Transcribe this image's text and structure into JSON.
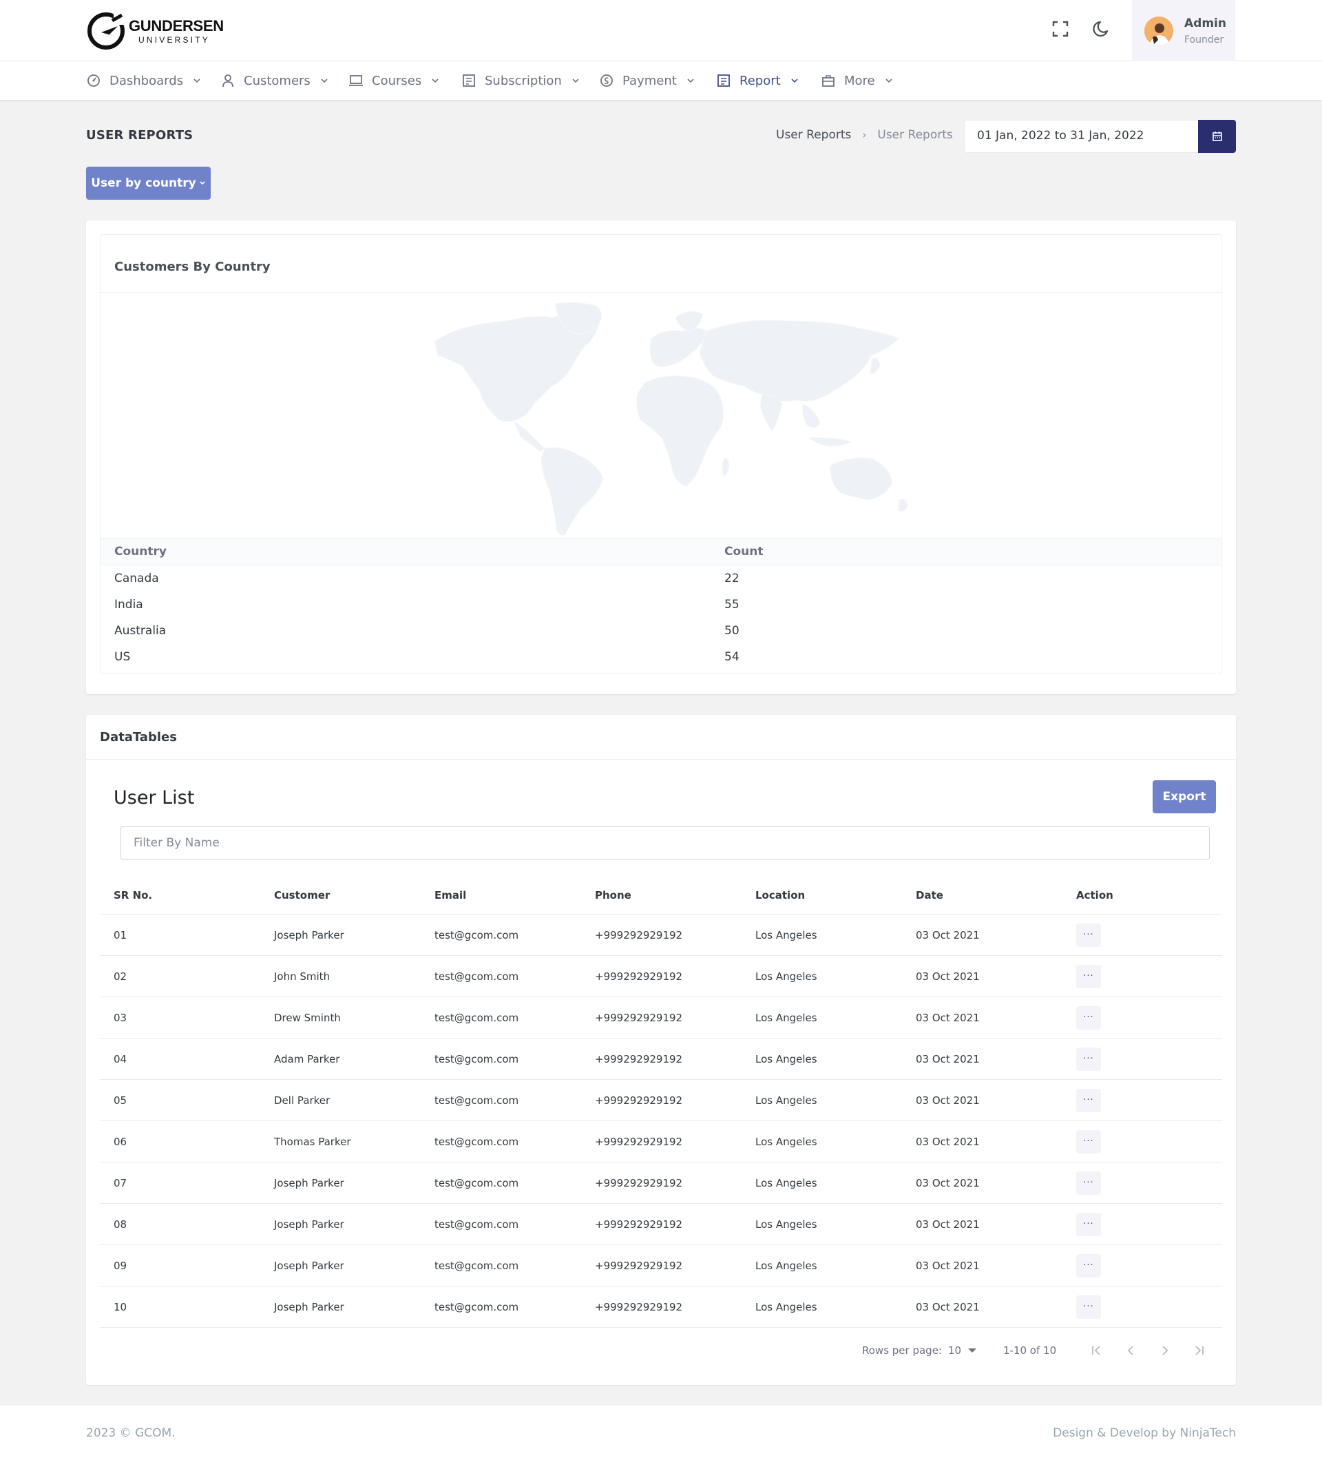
{
  "brand": {
    "name": "GUNDERSEN",
    "sub": "UNIVERSITY"
  },
  "header": {
    "icons": [
      "fullscreen-icon",
      "moon-icon"
    ],
    "user": {
      "name": "Admin",
      "role": "Founder"
    }
  },
  "nav": [
    {
      "label": "Dashboards",
      "icon": "dashboard-icon"
    },
    {
      "label": "Customers",
      "icon": "user-icon"
    },
    {
      "label": "Courses",
      "icon": "laptop-icon"
    },
    {
      "label": "Subscription",
      "icon": "subscription-icon"
    },
    {
      "label": "Payment",
      "icon": "coins-icon"
    },
    {
      "label": "Report",
      "icon": "report-icon",
      "active": true
    },
    {
      "label": "More",
      "icon": "briefcase-icon"
    }
  ],
  "page": {
    "title": "USER REPORTS",
    "breadcrumb": [
      "User Reports",
      "User Reports"
    ],
    "date_range": "01 Jan, 2022 to 31 Jan, 2022",
    "filter_button": "User by country"
  },
  "country_card": {
    "title": "Customers By Country",
    "columns": [
      "Country",
      "Count"
    ],
    "rows": [
      {
        "country": "Canada",
        "count": "22"
      },
      {
        "country": "India",
        "count": "55"
      },
      {
        "country": "Australia",
        "count": "50"
      },
      {
        "country": "US",
        "count": "54"
      }
    ]
  },
  "datatable": {
    "card_title": "DataTables",
    "list_title": "User List",
    "export_label": "Export",
    "filter_placeholder": "Filter By Name",
    "columns": [
      "SR No.",
      "Customer",
      "Email",
      "Phone",
      "Location",
      "Date",
      "Action"
    ],
    "rows": [
      {
        "sr": "01",
        "customer": "Joseph Parker",
        "email": "test@gcom.com",
        "phone": "+999292929192",
        "location": "Los Angeles",
        "date": "03 Oct 2021",
        "action": "···"
      },
      {
        "sr": "02",
        "customer": "John Smith",
        "email": "test@gcom.com",
        "phone": "+999292929192",
        "location": "Los Angeles",
        "date": "03 Oct 2021",
        "action": "···"
      },
      {
        "sr": "03",
        "customer": "Drew Sminth",
        "email": "test@gcom.com",
        "phone": "+999292929192",
        "location": "Los Angeles",
        "date": "03 Oct 2021",
        "action": "···"
      },
      {
        "sr": "04",
        "customer": "Adam Parker",
        "email": "test@gcom.com",
        "phone": "+999292929192",
        "location": "Los Angeles",
        "date": "03 Oct 2021",
        "action": "···"
      },
      {
        "sr": "05",
        "customer": "Dell Parker",
        "email": "test@gcom.com",
        "phone": "+999292929192",
        "location": "Los Angeles",
        "date": "03 Oct 2021",
        "action": "···"
      },
      {
        "sr": "06",
        "customer": "Thomas Parker",
        "email": "test@gcom.com",
        "phone": "+999292929192",
        "location": "Los Angeles",
        "date": "03 Oct 2021",
        "action": "···"
      },
      {
        "sr": "07",
        "customer": "Joseph Parker",
        "email": "test@gcom.com",
        "phone": "+999292929192",
        "location": "Los Angeles",
        "date": "03 Oct 2021",
        "action": "···"
      },
      {
        "sr": "08",
        "customer": "Joseph Parker",
        "email": "test@gcom.com",
        "phone": "+999292929192",
        "location": "Los Angeles",
        "date": "03 Oct 2021",
        "action": "···"
      },
      {
        "sr": "09",
        "customer": "Joseph Parker",
        "email": "test@gcom.com",
        "phone": "+999292929192",
        "location": "Los Angeles",
        "date": "03 Oct 2021",
        "action": "···"
      },
      {
        "sr": "10",
        "customer": "Joseph Parker",
        "email": "test@gcom.com",
        "phone": "+999292929192",
        "location": "Los Angeles",
        "date": "03 Oct 2021",
        "action": "···"
      }
    ],
    "pagination": {
      "rows_per_page_label": "Rows per page:",
      "rows_per_page": "10",
      "range": "1-10 of 10"
    }
  },
  "footer": {
    "left": "2023 © GCOM.",
    "right": "Design & Develop by NinjaTech"
  },
  "colors": {
    "accent": "#7082c9",
    "dark_accent": "#2b2e6e",
    "active_nav": "#405189",
    "map_fill": "#eef1f6"
  }
}
